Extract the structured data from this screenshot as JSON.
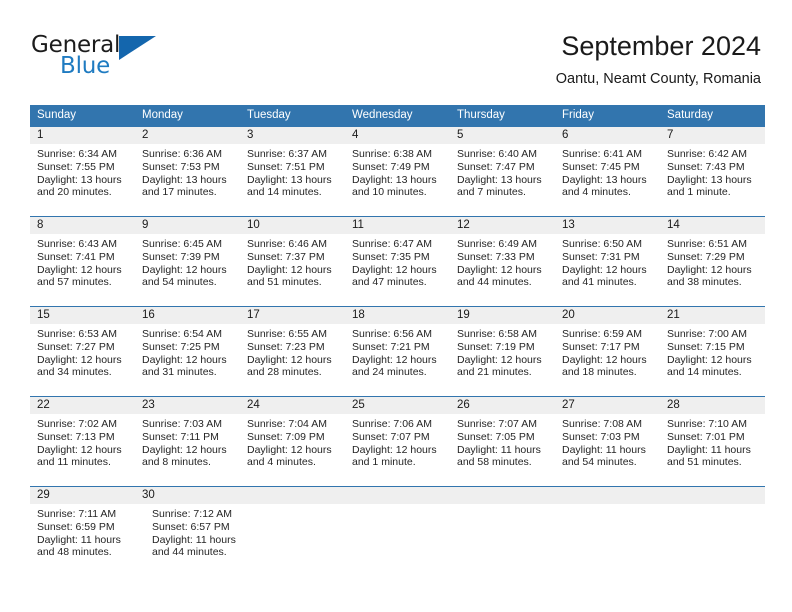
{
  "brand": {
    "line1": "General",
    "line2": "Blue",
    "triangle_color": "#1466ad",
    "blue_text_color": "#1f7bc1"
  },
  "header": {
    "title": "September 2024",
    "subtitle": "Oantu, Neamt County, Romania"
  },
  "colors": {
    "header_blue": "#3275ae",
    "day_band_gray": "#efefef",
    "text": "#1a1a1a"
  },
  "weekday_headers": [
    "Sunday",
    "Monday",
    "Tuesday",
    "Wednesday",
    "Thursday",
    "Friday",
    "Saturday"
  ],
  "weeks": [
    {
      "days": [
        {
          "num": "1",
          "sunrise": "Sunrise: 6:34 AM",
          "sunset": "Sunset: 7:55 PM",
          "daylight1": "Daylight: 13 hours",
          "daylight2": "and 20 minutes."
        },
        {
          "num": "2",
          "sunrise": "Sunrise: 6:36 AM",
          "sunset": "Sunset: 7:53 PM",
          "daylight1": "Daylight: 13 hours",
          "daylight2": "and 17 minutes."
        },
        {
          "num": "3",
          "sunrise": "Sunrise: 6:37 AM",
          "sunset": "Sunset: 7:51 PM",
          "daylight1": "Daylight: 13 hours",
          "daylight2": "and 14 minutes."
        },
        {
          "num": "4",
          "sunrise": "Sunrise: 6:38 AM",
          "sunset": "Sunset: 7:49 PM",
          "daylight1": "Daylight: 13 hours",
          "daylight2": "and 10 minutes."
        },
        {
          "num": "5",
          "sunrise": "Sunrise: 6:40 AM",
          "sunset": "Sunset: 7:47 PM",
          "daylight1": "Daylight: 13 hours",
          "daylight2": "and 7 minutes."
        },
        {
          "num": "6",
          "sunrise": "Sunrise: 6:41 AM",
          "sunset": "Sunset: 7:45 PM",
          "daylight1": "Daylight: 13 hours",
          "daylight2": "and 4 minutes."
        },
        {
          "num": "7",
          "sunrise": "Sunrise: 6:42 AM",
          "sunset": "Sunset: 7:43 PM",
          "daylight1": "Daylight: 13 hours",
          "daylight2": "and 1 minute."
        }
      ]
    },
    {
      "days": [
        {
          "num": "8",
          "sunrise": "Sunrise: 6:43 AM",
          "sunset": "Sunset: 7:41 PM",
          "daylight1": "Daylight: 12 hours",
          "daylight2": "and 57 minutes."
        },
        {
          "num": "9",
          "sunrise": "Sunrise: 6:45 AM",
          "sunset": "Sunset: 7:39 PM",
          "daylight1": "Daylight: 12 hours",
          "daylight2": "and 54 minutes."
        },
        {
          "num": "10",
          "sunrise": "Sunrise: 6:46 AM",
          "sunset": "Sunset: 7:37 PM",
          "daylight1": "Daylight: 12 hours",
          "daylight2": "and 51 minutes."
        },
        {
          "num": "11",
          "sunrise": "Sunrise: 6:47 AM",
          "sunset": "Sunset: 7:35 PM",
          "daylight1": "Daylight: 12 hours",
          "daylight2": "and 47 minutes."
        },
        {
          "num": "12",
          "sunrise": "Sunrise: 6:49 AM",
          "sunset": "Sunset: 7:33 PM",
          "daylight1": "Daylight: 12 hours",
          "daylight2": "and 44 minutes."
        },
        {
          "num": "13",
          "sunrise": "Sunrise: 6:50 AM",
          "sunset": "Sunset: 7:31 PM",
          "daylight1": "Daylight: 12 hours",
          "daylight2": "and 41 minutes."
        },
        {
          "num": "14",
          "sunrise": "Sunrise: 6:51 AM",
          "sunset": "Sunset: 7:29 PM",
          "daylight1": "Daylight: 12 hours",
          "daylight2": "and 38 minutes."
        }
      ]
    },
    {
      "days": [
        {
          "num": "15",
          "sunrise": "Sunrise: 6:53 AM",
          "sunset": "Sunset: 7:27 PM",
          "daylight1": "Daylight: 12 hours",
          "daylight2": "and 34 minutes."
        },
        {
          "num": "16",
          "sunrise": "Sunrise: 6:54 AM",
          "sunset": "Sunset: 7:25 PM",
          "daylight1": "Daylight: 12 hours",
          "daylight2": "and 31 minutes."
        },
        {
          "num": "17",
          "sunrise": "Sunrise: 6:55 AM",
          "sunset": "Sunset: 7:23 PM",
          "daylight1": "Daylight: 12 hours",
          "daylight2": "and 28 minutes."
        },
        {
          "num": "18",
          "sunrise": "Sunrise: 6:56 AM",
          "sunset": "Sunset: 7:21 PM",
          "daylight1": "Daylight: 12 hours",
          "daylight2": "and 24 minutes."
        },
        {
          "num": "19",
          "sunrise": "Sunrise: 6:58 AM",
          "sunset": "Sunset: 7:19 PM",
          "daylight1": "Daylight: 12 hours",
          "daylight2": "and 21 minutes."
        },
        {
          "num": "20",
          "sunrise": "Sunrise: 6:59 AM",
          "sunset": "Sunset: 7:17 PM",
          "daylight1": "Daylight: 12 hours",
          "daylight2": "and 18 minutes."
        },
        {
          "num": "21",
          "sunrise": "Sunrise: 7:00 AM",
          "sunset": "Sunset: 7:15 PM",
          "daylight1": "Daylight: 12 hours",
          "daylight2": "and 14 minutes."
        }
      ]
    },
    {
      "days": [
        {
          "num": "22",
          "sunrise": "Sunrise: 7:02 AM",
          "sunset": "Sunset: 7:13 PM",
          "daylight1": "Daylight: 12 hours",
          "daylight2": "and 11 minutes."
        },
        {
          "num": "23",
          "sunrise": "Sunrise: 7:03 AM",
          "sunset": "Sunset: 7:11 PM",
          "daylight1": "Daylight: 12 hours",
          "daylight2": "and 8 minutes."
        },
        {
          "num": "24",
          "sunrise": "Sunrise: 7:04 AM",
          "sunset": "Sunset: 7:09 PM",
          "daylight1": "Daylight: 12 hours",
          "daylight2": "and 4 minutes."
        },
        {
          "num": "25",
          "sunrise": "Sunrise: 7:06 AM",
          "sunset": "Sunset: 7:07 PM",
          "daylight1": "Daylight: 12 hours",
          "daylight2": "and 1 minute."
        },
        {
          "num": "26",
          "sunrise": "Sunrise: 7:07 AM",
          "sunset": "Sunset: 7:05 PM",
          "daylight1": "Daylight: 11 hours",
          "daylight2": "and 58 minutes."
        },
        {
          "num": "27",
          "sunrise": "Sunrise: 7:08 AM",
          "sunset": "Sunset: 7:03 PM",
          "daylight1": "Daylight: 11 hours",
          "daylight2": "and 54 minutes."
        },
        {
          "num": "28",
          "sunrise": "Sunrise: 7:10 AM",
          "sunset": "Sunset: 7:01 PM",
          "daylight1": "Daylight: 11 hours",
          "daylight2": "and 51 minutes."
        }
      ]
    },
    {
      "days": [
        {
          "num": "29",
          "sunrise": "Sunrise: 7:11 AM",
          "sunset": "Sunset: 6:59 PM",
          "daylight1": "Daylight: 11 hours",
          "daylight2": "and 48 minutes."
        },
        {
          "num": "30",
          "sunrise": "Sunrise: 7:12 AM",
          "sunset": "Sunset: 6:57 PM",
          "daylight1": "Daylight: 11 hours",
          "daylight2": "and 44 minutes."
        }
      ]
    }
  ]
}
